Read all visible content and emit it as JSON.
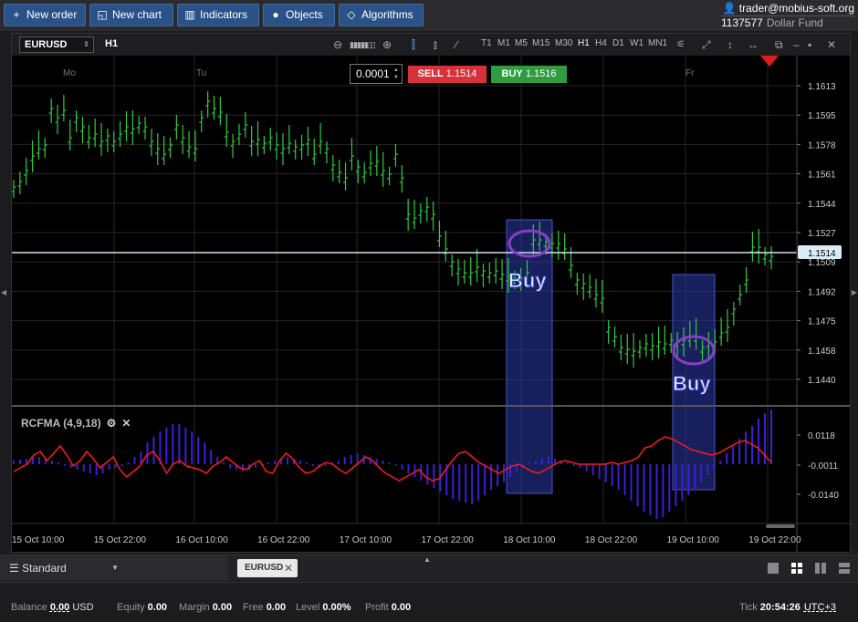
{
  "toolbar": {
    "new_order": "New order",
    "new_chart": "New chart",
    "indicators": "Indicators",
    "objects": "Objects",
    "algorithms": "Algorithms"
  },
  "account": {
    "user": "trader@mobius-soft.org",
    "number": "1137577",
    "fund": "Dollar Fund"
  },
  "chart": {
    "symbol": "EURUSD",
    "timeframe": "H1",
    "timeframes": [
      "T1",
      "M1",
      "M5",
      "M15",
      "M30",
      "H1",
      "H4",
      "D1",
      "W1",
      "MN1"
    ],
    "active_timeframe": "H1"
  },
  "trade": {
    "lot": "0.0001",
    "sell_label": "SELL",
    "sell_price": "1.1514",
    "buy_label": "BUY",
    "buy_price": "1.1516"
  },
  "indicator": {
    "name": "RCFMA (4,9,18)"
  },
  "annotations": {
    "buy1": "Buy",
    "buy2": "Buy"
  },
  "chart_data": {
    "type": "candlestick",
    "price_axis_ticks": [
      "1.1613",
      "1.1595",
      "1.1578",
      "1.1561",
      "1.1544",
      "1.1527",
      "1.1509",
      "1.1492",
      "1.1475",
      "1.1458",
      "1.1440"
    ],
    "current_price": "1.1514",
    "day_labels": [
      "Mo",
      "Tu",
      "Fr"
    ],
    "time_axis_labels": [
      "15 Oct 10:00",
      "15 Oct 22:00",
      "16 Oct 10:00",
      "16 Oct 22:00",
      "17 Oct 10:00",
      "17 Oct 22:00",
      "18 Oct 10:00",
      "18 Oct 22:00",
      "19 Oct 10:00",
      "19 Oct 22:00"
    ],
    "indicator_axis_ticks": [
      "0.0118",
      "-0.0011",
      "-0.0140"
    ],
    "colors": {
      "bull": "#2ecc40",
      "line": "#ff1a1a",
      "hist": "#3d1fd6",
      "highlight": "#2a3aa8"
    }
  },
  "tabs": {
    "workspace": "Standard",
    "active_tab": "EURUSD"
  },
  "status": {
    "balance_label": "Balance",
    "balance": "0.00",
    "currency": "USD",
    "equity_label": "Equity",
    "equity": "0.00",
    "margin_label": "Margin",
    "margin": "0.00",
    "free_label": "Free",
    "free": "0.00",
    "level_label": "Level",
    "level": "0.00%",
    "profit_label": "Profit",
    "profit": "0.00",
    "tick_label": "Tick",
    "time": "20:54:26",
    "timezone": "UTC+3"
  }
}
